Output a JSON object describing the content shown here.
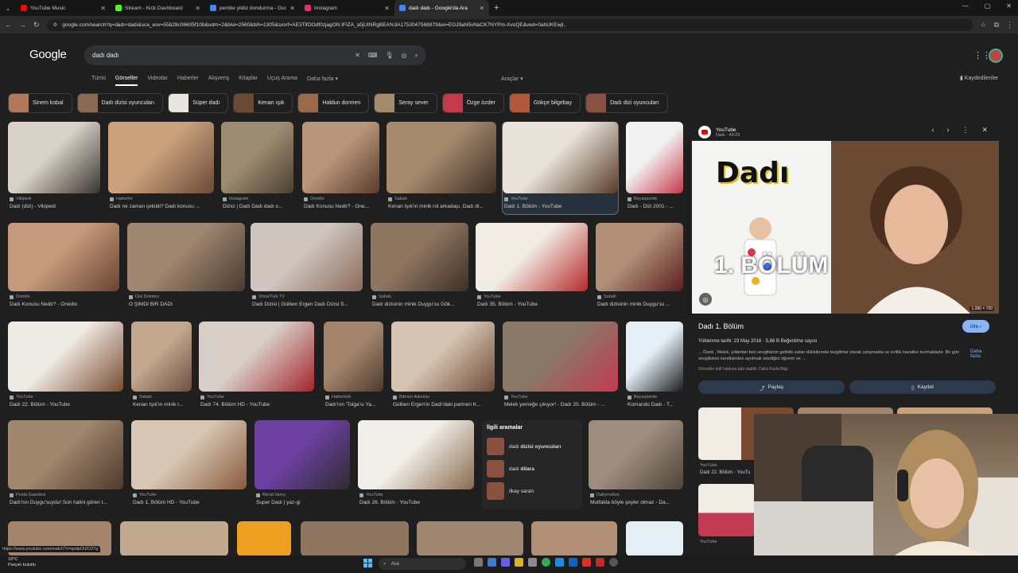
{
  "tabs": [
    {
      "title": "YouTube Music",
      "color": "#ff0000"
    },
    {
      "title": "Stream - Kick Dashboard",
      "color": "#53fc18"
    },
    {
      "title": "pembe yildiz dondurma - Goog",
      "color": "#4285f4"
    },
    {
      "title": "Instagram",
      "color": "#e1306c"
    },
    {
      "title": "dadı dadı - Google'da Ara",
      "color": "#4285f4"
    }
  ],
  "address": "google.com/search?q=dadı+dadı&sca_esv=55b28c06605f10b&udm=2&biw=2560&bih=1305&sxsrf=AE3TifOOdf0zjagON.IFIZA_a5jUINRgBEA%3A1753047568879&ei=EGJ9aN5vNaCK7NYPm-XvoQE&ved=0ahUKEwjI..",
  "search": {
    "query": "dadı dadı"
  },
  "logo": "Google",
  "filters": [
    "Tümü",
    "Görseller",
    "Videolar",
    "Haberler",
    "Alışveriş",
    "Kitaplar",
    "Uçuş Arama",
    "Daha fazla ▾"
  ],
  "tools": "Araçlar ▾",
  "saved": "Kaydedilenler",
  "chips": [
    "Sinem kobal",
    "Dadı dizisi oyuncuları",
    "Süper dadı",
    "Kenan ışık",
    "Haldun dormen",
    "Seray sever",
    "Özge özder",
    "Gökçe bilgebay",
    "Dadı dizi oyuncuları"
  ],
  "results": [
    {
      "src": "Vikipedi",
      "cap": "Dadı (dizi) - Vikipedi",
      "c1": "#d8d2c8",
      "c2": "#3a3430"
    },
    {
      "src": "Haberler",
      "cap": "Dadı ne zaman çekildi? Dadı konusu ...",
      "c1": "#c9a27d",
      "c2": "#6a4a38"
    },
    {
      "src": "Instagram",
      "cap": "Dizici | Dadı Dadı dadı o...",
      "c1": "#9d8c72",
      "c2": "#4a3f33"
    },
    {
      "src": "Onedio",
      "cap": "Dadı Konusu Nedir? - One...",
      "c1": "#b7967a",
      "c2": "#5b3a2c"
    },
    {
      "src": "Sabah",
      "cap": "Kenan Işık'ın minik rol arkadaşı, Dadı di...",
      "c1": "#a58a6d",
      "c2": "#3d2e25"
    },
    {
      "src": "YouTube",
      "cap": "Dadı 1. Bölüm - YouTube",
      "c1": "#e8e4dc",
      "c2": "#5a3a28"
    },
    {
      "src": "Beyazperde",
      "cap": "Dadı - Dizi 2001 - ...",
      "c1": "#f2f2f2",
      "c2": "#c43a4a"
    },
    {
      "src": "Onedio",
      "cap": "Dadı Konusu Nedir? - Onedio",
      "c1": "#c59a7c",
      "c2": "#6b4432"
    },
    {
      "src": "Dizi Doktoru",
      "cap": "O ŞİMDİ BİR DADI",
      "c1": "#9e8670",
      "c2": "#4b3a2f"
    },
    {
      "src": "ShowTürk TV",
      "cap": "Dadı Dizisi | Gülben Ergen Dadı Dizisi S...",
      "c1": "#cfc6c0",
      "c2": "#8b6b5a"
    },
    {
      "src": "Sabah",
      "cap": "Dadı dizisinin minik Duygu'su Gök...",
      "c1": "#8d7560",
      "c2": "#3c2f27"
    },
    {
      "src": "YouTube",
      "cap": "Dadı 35. Bölüm - YouTube",
      "c1": "#f0ece4",
      "c2": "#b52a2a"
    },
    {
      "src": "Sabah",
      "cap": "Dadı dizisinin minik Duygu'su ...",
      "c1": "#b08f76",
      "c2": "#5a1e22"
    },
    {
      "src": "YouTube",
      "cap": "Dadı 22. Bölüm - YouTube",
      "c1": "#eeeae4",
      "c2": "#7a4a30"
    },
    {
      "src": "Sabah",
      "cap": "Kenan Işık'ın minik r...",
      "c1": "#c2a88f",
      "c2": "#6b5040"
    },
    {
      "src": "YouTube",
      "cap": "Dadı 74. Bölüm HD - YouTube",
      "c1": "#d8d0c8",
      "c2": "#a4242c"
    },
    {
      "src": "Habertürk",
      "cap": "Dadı'nın 'Tolga'sı Ya...",
      "c1": "#a4856c",
      "c2": "#4c3b30"
    },
    {
      "src": "Bitmen Adunlay",
      "cap": "Gülben Ergen'in Dadı'daki partneri K...",
      "c1": "#d6c4b2",
      "c2": "#6e4b38"
    },
    {
      "src": "YouTube",
      "cap": "Melek yemeğe çıkıyor! - Dadı 20. Bölüm - ...",
      "c1": "#8a7868",
      "c2": "#c23b52"
    },
    {
      "src": "Beyazperde",
      "cap": "Komando Dadı - T...",
      "c1": "#e4eef5",
      "c2": "#1c1c1c"
    },
    {
      "src": "Posta Gazetesi",
      "cap": "Dadı'nın Duygu'suydu! Son halini gören t...",
      "c1": "#a0886f",
      "c2": "#4d3a2d"
    },
    {
      "src": "YouTube",
      "cap": "Dadı 1. Bölüm HD - YouTube",
      "c1": "#d8c7b4",
      "c2": "#8a5a3c"
    },
    {
      "src": "Meral Varuy",
      "cap": "Super Dadı | yaz-gi",
      "c1": "#6c3fa0",
      "c2": "#2d2d2d"
    },
    {
      "src": "YouTube",
      "cap": "Dadı 26. Bölüm - YouTube",
      "c1": "#f1efea",
      "c2": "#8a6a50"
    },
    {
      "src": "Dailymotion",
      "cap": "Mutfakta böyle şeyler olmaz - Da...",
      "c1": "#9c8d7e",
      "c2": "#4f4338"
    }
  ],
  "related": {
    "title": "İlgili aramalar",
    "items": [
      {
        "pre": "dadı ",
        "bold": "dizisi oyuncuları"
      },
      {
        "pre": "dadı ",
        "bold": "dilara"
      },
      {
        "pre": "",
        "bold": "",
        "plain": "ilkay saran"
      }
    ]
  },
  "panel": {
    "site": "YouTube",
    "sub": "Dadı · 43:29",
    "image_title": "Dadı",
    "episode": "1. BÖLÜM",
    "dims": "1.280 × 720",
    "title": "Dadı 1. Bölüm",
    "watch": "İzle ›",
    "meta": "Yüklenme tarihi: 23 May 2016 · 5,66 B Beğenilme sayısı",
    "desc": "... Özeti , Melek, yıllardan beri sevgilisinin gelinlik satan dükkânında tezgâhtar olarak çalışmakta ve evlilik havalleri kurmaktadır. Bir gün sevgilisinin kendisinden ayrılmak istediğini öğrenir ve ...",
    "more": "Daha fazla",
    "copyright": "Görseller telif hakkına tabi olabilir. Daha Fazla Bilgi",
    "share": "Paylaş",
    "save": "Kaydet",
    "tiles": [
      {
        "src": "YouTube",
        "cap": "Dadı 22. Bölüm - YouTu"
      },
      {
        "src": "YouTube",
        "cap": ""
      }
    ]
  },
  "statusbar": "https://www.youtube.com/watch?v=qxdpOiZO27g",
  "weather": {
    "temp": "19°C",
    "desc": "Parçalı bulutlu"
  },
  "taskbar_search": "Ara"
}
